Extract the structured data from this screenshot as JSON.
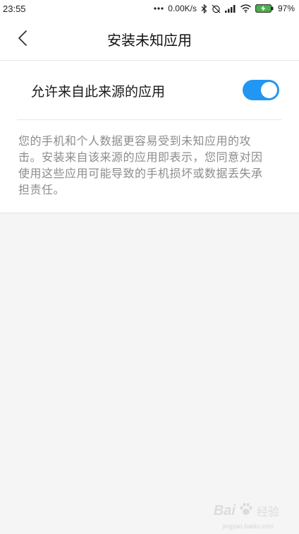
{
  "status_bar": {
    "time": "23:55",
    "net_speed": "0.00K/s",
    "battery_percent": "97%",
    "icons": [
      "dots-icon",
      "bluetooth-icon",
      "alarm-off-icon",
      "signal-icon",
      "wifi-icon",
      "battery-charging-icon"
    ]
  },
  "header": {
    "title": "安装未知应用",
    "back_icon": "chevron-left-icon"
  },
  "setting": {
    "label": "允许来自此来源的应用",
    "toggle_on": true,
    "toggle_color": "#2196f3"
  },
  "description": "您的手机和个人数据更容易受到未知应用的攻击。安装来自该来源的应用即表示，您同意对因使用这些应用可能导致的手机损坏或数据丢失承担责任。",
  "watermark": {
    "brand": "Bai",
    "brand_suffix": "经验",
    "url": "jingyan.baidu.com"
  }
}
